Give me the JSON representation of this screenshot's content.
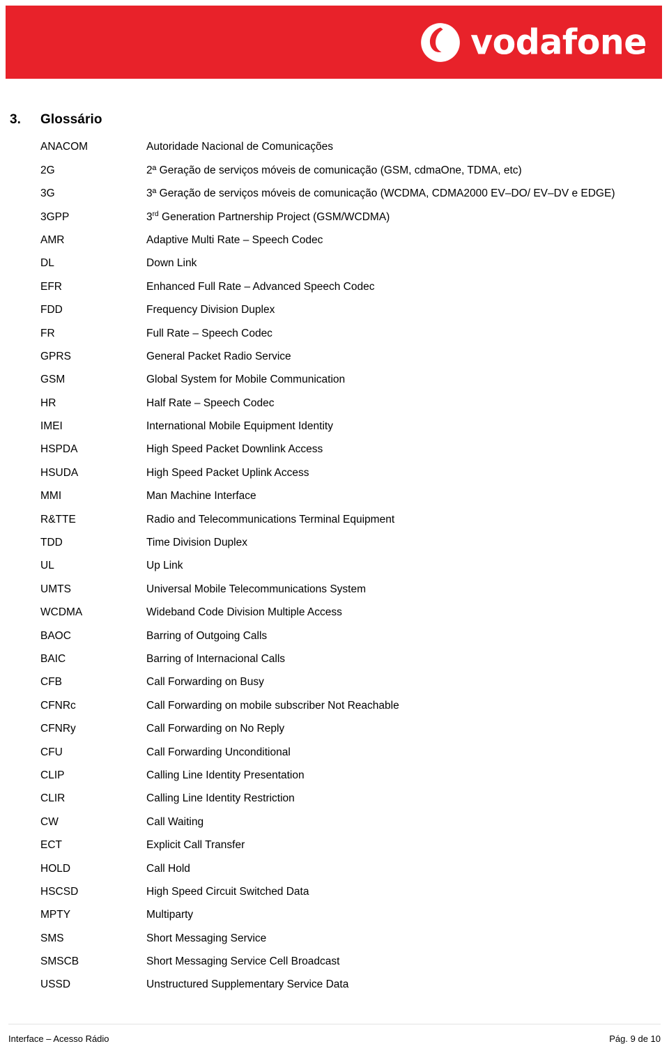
{
  "header": {
    "brand_name": "vodafone",
    "brand_red": "#e8222a",
    "logo_icon": "vodafone-speechmark-logo"
  },
  "section": {
    "number": "3.",
    "title": "Glossário"
  },
  "glossary": {
    "rows": [
      {
        "term": "ANACOM",
        "definition": "Autoridade Nacional de Comunicações"
      },
      {
        "term": "2G",
        "definition": "2ª Geração de serviços móveis de comunicação (GSM, cdmaOne, TDMA, etc)"
      },
      {
        "term": "3G",
        "definition": "3ª Geração de serviços móveis de comunicação (WCDMA, CDMA2000 EV–DO/ EV–DV e EDGE)"
      },
      {
        "term": "3GPP",
        "definition_pre": "3",
        "definition_sup": "rd",
        "definition_post": " Generation Partnership Project (GSM/WCDMA)",
        "definition": "3rd Generation Partnership Project (GSM/WCDMA)"
      },
      {
        "term": "AMR",
        "definition": "Adaptive Multi Rate – Speech Codec"
      },
      {
        "term": "DL",
        "definition": "Down Link"
      },
      {
        "term": "EFR",
        "definition": "Enhanced Full Rate – Advanced Speech Codec"
      },
      {
        "term": "FDD",
        "definition": "Frequency Division Duplex"
      },
      {
        "term": "FR",
        "definition": "Full Rate – Speech Codec"
      },
      {
        "term": "GPRS",
        "definition": "General Packet Radio Service"
      },
      {
        "term": "GSM",
        "definition": "Global System for Mobile Communication"
      },
      {
        "term": "HR",
        "definition": "Half Rate – Speech Codec"
      },
      {
        "term": "IMEI",
        "definition": "International Mobile Equipment Identity"
      },
      {
        "term": "HSPDA",
        "definition": "High Speed Packet Downlink Access"
      },
      {
        "term": "HSUDA",
        "definition": "High Speed Packet Uplink Access"
      },
      {
        "term": "MMI",
        "definition": "Man Machine Interface"
      },
      {
        "term": "R&TTE",
        "definition": "Radio and Telecommunications Terminal Equipment"
      },
      {
        "term": "TDD",
        "definition": "Time Division Duplex"
      },
      {
        "term": "UL",
        "definition": "Up Link"
      },
      {
        "term": "UMTS",
        "definition": "Universal Mobile Telecommunications System"
      },
      {
        "term": "WCDMA",
        "definition": "Wideband Code Division Multiple Access"
      },
      {
        "term": "BAOC",
        "definition": "Barring of Outgoing Calls"
      },
      {
        "term": "BAIC",
        "definition": "Barring of Internacional Calls"
      },
      {
        "term": "CFB",
        "definition": "Call Forwarding on Busy"
      },
      {
        "term": "CFNRc",
        "definition": "Call Forwarding on mobile subscriber Not Reachable"
      },
      {
        "term": "CFNRy",
        "definition": "Call Forwarding on No Reply"
      },
      {
        "term": "CFU",
        "definition": "Call Forwarding Unconditional"
      },
      {
        "term": "CLIP",
        "definition": "Calling Line Identity Presentation"
      },
      {
        "term": "CLIR",
        "definition": "Calling Line Identity Restriction"
      },
      {
        "term": "CW",
        "definition": "Call Waiting"
      },
      {
        "term": "ECT",
        "definition": "Explicit Call Transfer"
      },
      {
        "term": "HOLD",
        "definition": "Call Hold"
      },
      {
        "term": "HSCSD",
        "definition": "High Speed Circuit Switched Data"
      },
      {
        "term": "MPTY",
        "definition": "Multiparty"
      },
      {
        "term": "SMS",
        "definition": "Short Messaging Service"
      },
      {
        "term": "SMSCB",
        "definition": "Short Messaging Service Cell Broadcast"
      },
      {
        "term": "USSD",
        "definition": "Unstructured Supplementary Service Data"
      }
    ]
  },
  "footer": {
    "document_title": "Interface – Acesso Rádio",
    "page_label": "Pág. 9 de 10"
  }
}
